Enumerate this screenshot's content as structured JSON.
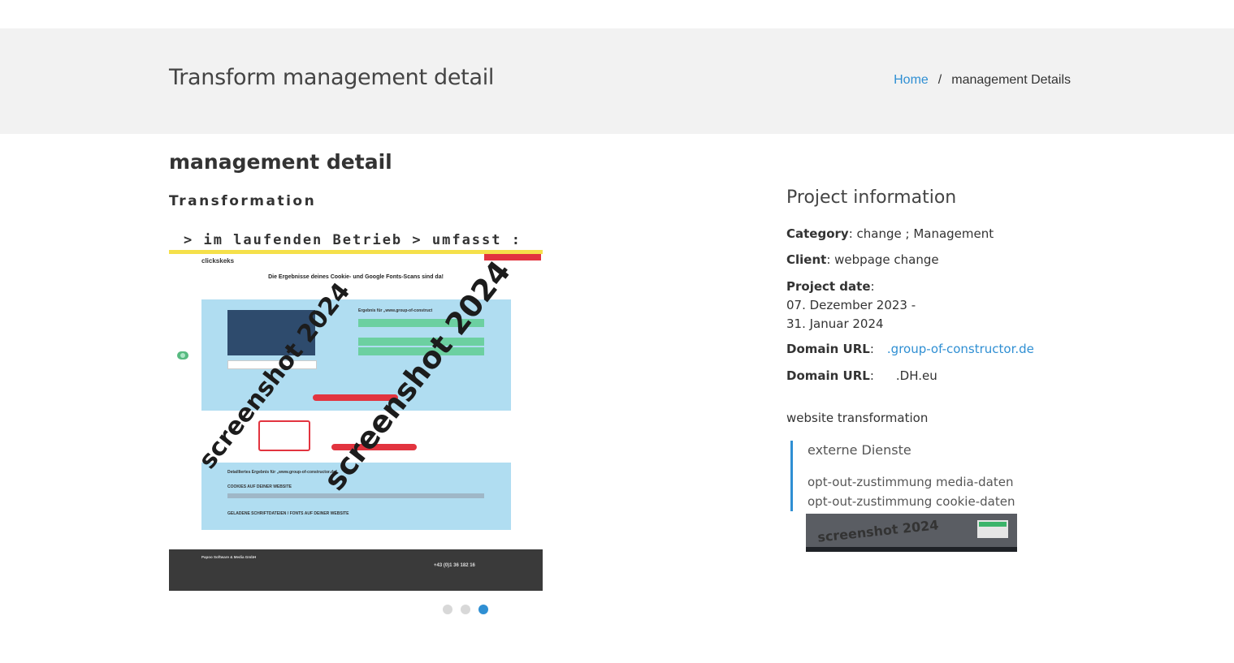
{
  "banner": {
    "title": "Transform management detail",
    "breadcrumb": {
      "home": "Home",
      "separator": "/",
      "current": "management Details"
    }
  },
  "main": {
    "title": "management detail",
    "subtitle": "Transformation",
    "scope_line": ">  im laufenden Betrieb  >  umfasst :",
    "screenshot": {
      "watermark": "screenshot 2024",
      "logo": "clickskeks",
      "headline": "Die Ergebnisse deines Cookie- und Google Fonts-Scans sind da!",
      "result_label": "Ergebnis für „www.group-of-construct",
      "detail_label": "Detailliertes Ergebnis für „www.group-of-constructor.de\"",
      "cookies_label": "COOKIES AUF DEINER WEBSITE",
      "fonts_label": "GELADENE SCHRIFTDATEIEN / FONTS AUF DEINER WEBSITE",
      "footer_company": "Papoo Software & Media GmbH",
      "footer_phone": "+43 (0)1 36 182 16"
    },
    "slider": {
      "dots": 3,
      "active_index": 2
    }
  },
  "project": {
    "title": "Project information",
    "category_label": "Category",
    "category_value": ": change ; Management",
    "client_label": "Client",
    "client_value": ": webpage change",
    "date_label": "Project date",
    "date_colon": ":",
    "date_line1": "07. Dezember 2023 -",
    "date_line2": "31. Januar 2024",
    "domain1_label": "Domain URL",
    "domain1_colon": ":",
    "domain1_value": ".group-of-constructor.de",
    "domain2_label": "Domain URL",
    "domain2_colon": ":",
    "domain2_value": ".DH.eu",
    "website_transformation": "website transformation",
    "quote_title": "externe Dienste",
    "quote_line1": "opt-out-zustimmung media-daten",
    "quote_line2": "opt-out-zustimmung cookie-daten",
    "thumb_watermark": "screenshot 2024"
  },
  "colors": {
    "accent": "#2f8fd3",
    "banner_bg": "#f2f2f2",
    "light_blue": "#b0ddf1",
    "green": "#6cd0a1",
    "red": "#e2343f"
  }
}
